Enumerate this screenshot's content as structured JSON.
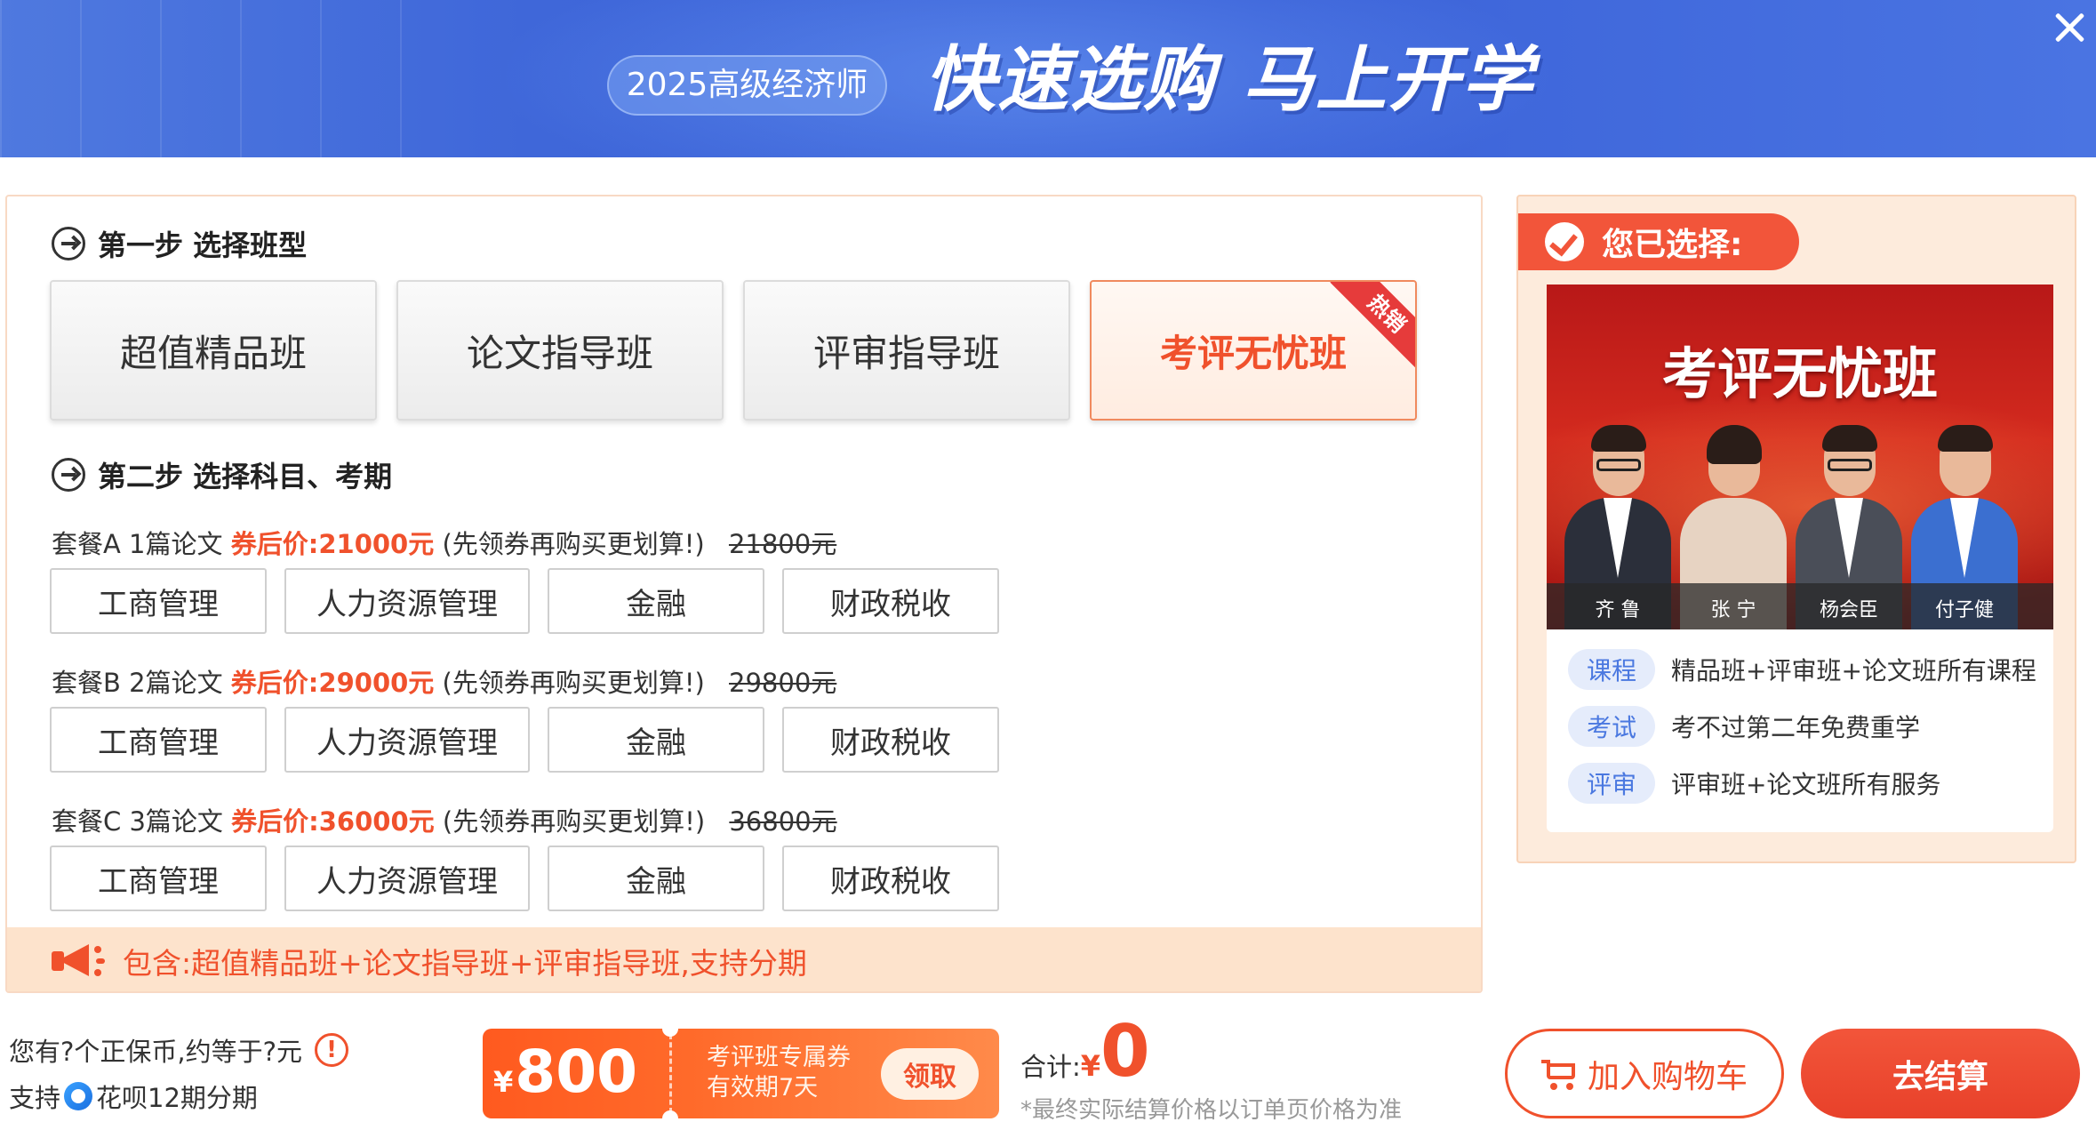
{
  "header": {
    "year_tag": "2025高级经济师",
    "slogan": "快速选购 马上开学"
  },
  "step1": {
    "title": "第一步 选择班型",
    "classes": [
      {
        "label": "超值精品班",
        "selected": false
      },
      {
        "label": "论文指导班",
        "selected": false
      },
      {
        "label": "评审指导班",
        "selected": false
      },
      {
        "label": "考评无忧班",
        "selected": true,
        "badge": "热销"
      }
    ]
  },
  "step2": {
    "title": "第二步 选择科目、考期",
    "packages": [
      {
        "name": "套餐A 1篇论文",
        "coupon_label": "券后价:",
        "coupon_price": "21000元",
        "note": "(先领券再购买更划算!)",
        "original_price": "21800元",
        "subjects": [
          "工商管理",
          "人力资源管理",
          "金融",
          "财政税收"
        ]
      },
      {
        "name": "套餐B 2篇论文",
        "coupon_label": "券后价:",
        "coupon_price": "29000元",
        "note": "(先领券再购买更划算!)",
        "original_price": "29800元",
        "subjects": [
          "工商管理",
          "人力资源管理",
          "金融",
          "财政税收"
        ]
      },
      {
        "name": "套餐C 3篇论文",
        "coupon_label": "券后价:",
        "coupon_price": "36000元",
        "note": "(先领券再购买更划算!)",
        "original_price": "36800元",
        "subjects": [
          "工商管理",
          "人力资源管理",
          "金融",
          "财政税收"
        ]
      }
    ]
  },
  "include_bar": {
    "text": "包含:超值精品班+论文指导班+评审指导班,支持分期"
  },
  "selection": {
    "header": "您已选择:",
    "image_title": "考评无忧班",
    "teachers": [
      "齐 鲁",
      "张 宁",
      "杨会臣",
      "付子健"
    ],
    "features": [
      {
        "tag": "课程",
        "text": "精品班+评审班+论文班所有课程"
      },
      {
        "tag": "考试",
        "text": "考不过第二年免费重学"
      },
      {
        "tag": "评审",
        "text": "评审班+论文班所有服务"
      }
    ]
  },
  "footer": {
    "coin_text": "您有?个正保币,约等于?元",
    "warn_symbol": "!",
    "installment_prefix": "支持",
    "installment_text": "花呗12期分期",
    "coupon": {
      "currency": "¥",
      "amount": "800",
      "desc_line1": "考评班专属券",
      "desc_line2": "有效期7天",
      "claim_label": "领取"
    },
    "total_label": "合计:",
    "total_currency": "¥",
    "total_amount": "0",
    "footnote": "*最终实际结算价格以订单页价格为准",
    "cart_label": "加入购物车",
    "checkout_label": "去结算"
  },
  "colors": {
    "accent": "#f0512c",
    "header_blue": "#3f67d9",
    "tag_blue": "#4a78e0",
    "panel_peach": "#fdebdc"
  }
}
